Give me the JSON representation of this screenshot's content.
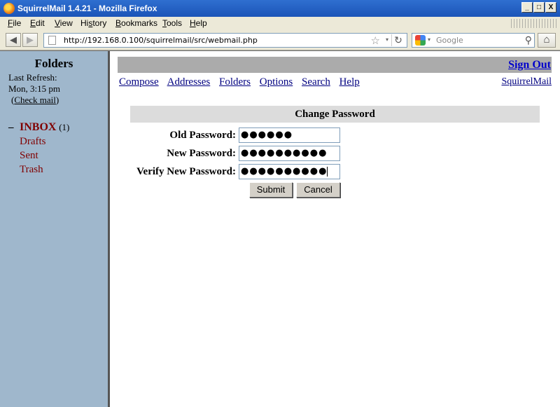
{
  "window": {
    "title": "SquirrelMail 1.4.21 - Mozilla Firefox",
    "controls": {
      "minimize": "_",
      "maximize": "□",
      "close": "X"
    }
  },
  "menubar": {
    "items": [
      {
        "label": "File",
        "mnemonic": "F",
        "rest": "ile"
      },
      {
        "label": "Edit",
        "mnemonic": "E",
        "rest": "dit"
      },
      {
        "label": "View",
        "mnemonic": "V",
        "rest": "iew"
      },
      {
        "label": "History",
        "mnemonic": "",
        "pre": "Hi",
        "mn2": "s",
        "rest": "tory"
      },
      {
        "label": "Bookmarks",
        "mnemonic": "B",
        "rest": "ookmarks"
      },
      {
        "label": "Tools",
        "mnemonic": "T",
        "rest": "ools"
      },
      {
        "label": "Help",
        "mnemonic": "H",
        "rest": "elp"
      }
    ]
  },
  "navbar": {
    "back_glyph": "◀",
    "forward_glyph": "▶",
    "url": "http://192.168.0.100/squirrelmail/src/webmail.php",
    "bookmark_star": "☆",
    "dropdown_glyph": "▾",
    "reload_glyph": "↻",
    "search_placeholder": "Google",
    "search_glyph": "⚲",
    "home_glyph": "⌂"
  },
  "sidebar": {
    "title": "Folders",
    "last_refresh_label": "Last Refresh:",
    "last_refresh_time": "Mon, 3:15 pm",
    "check_mail_open": "(",
    "check_mail": "Check mail",
    "check_mail_close": ")",
    "collapse_glyph": "–",
    "folders": [
      {
        "name": "INBOX",
        "count": "(1)"
      },
      {
        "name": "Drafts"
      },
      {
        "name": "Sent"
      },
      {
        "name": "Trash"
      }
    ]
  },
  "main": {
    "sign_out": "Sign Out",
    "nav": [
      "Compose",
      "Addresses",
      "Folders",
      "Options",
      "Search",
      "Help"
    ],
    "brand_link": "SquirrelMail",
    "form": {
      "heading": "Change Password",
      "old_label": "Old Password:",
      "old_value": "●●●●●●",
      "new_label": "New Password:",
      "new_value": "●●●●●●●●●●",
      "verify_label": "Verify New Password:",
      "verify_value": "●●●●●●●●●●",
      "submit": "Submit",
      "cancel": "Cancel"
    }
  },
  "colors": {
    "sidebar_bg": "#9fb7cc",
    "folder_link": "#800000",
    "header_bar": "#ababab",
    "form_header": "#dcdcdc",
    "link": "#000080"
  }
}
